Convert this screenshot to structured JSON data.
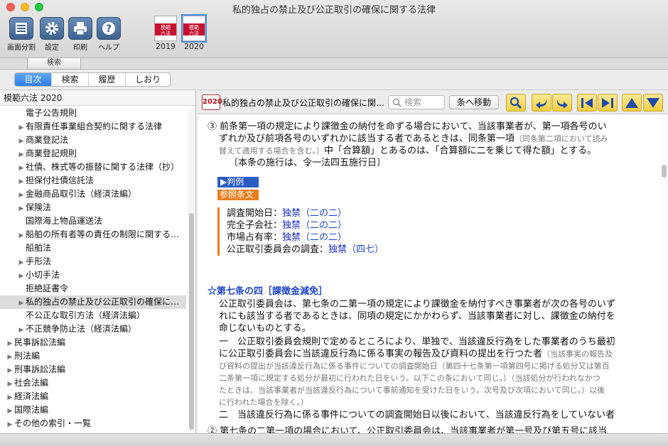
{
  "window": {
    "title": "私的独占の禁止及び公正取引の確保に関する法律"
  },
  "toolbar": {
    "split_label": "画面分割",
    "settings_label": "設定",
    "print_label": "印刷",
    "help_label": "ヘルプ",
    "book_2019_label": "2019",
    "book_2020_label": "2020",
    "book_cover_text_line1": "模範",
    "book_cover_text_line2": "六法",
    "book_2019_cover_year": "2019",
    "book_2020_cover_year": "2020",
    "search_tab_label": "検索"
  },
  "tabs": [
    {
      "label": "目次",
      "active": true
    },
    {
      "label": "検索",
      "active": false
    },
    {
      "label": "履歴",
      "active": false
    },
    {
      "label": "しおり",
      "active": false
    }
  ],
  "sidebar": {
    "header": "模範六法 2020",
    "items": [
      {
        "label": "電子公告規則",
        "level": "l2n",
        "arrow": ""
      },
      {
        "label": "有限責任事業組合契約に関する法律",
        "level": "l2",
        "arrow": "▶"
      },
      {
        "label": "商業登記法",
        "level": "l2",
        "arrow": "▶"
      },
      {
        "label": "商業登記規則",
        "level": "l2",
        "arrow": "▶"
      },
      {
        "label": "社債、株式等の振替に関する法律（抄）",
        "level": "l2",
        "arrow": "▶"
      },
      {
        "label": "担保付社債信託法",
        "level": "l2",
        "arrow": "▶"
      },
      {
        "label": "金融商品取引法（経済法編）",
        "level": "l2",
        "arrow": "▶"
      },
      {
        "label": "保険法",
        "level": "l2",
        "arrow": "▶"
      },
      {
        "label": "国際海上物品運送法",
        "level": "l2n",
        "arrow": ""
      },
      {
        "label": "船舶の所有者等の責任の制限に関する…",
        "level": "l2",
        "arrow": "▶"
      },
      {
        "label": "船舶法",
        "level": "l2n",
        "arrow": ""
      },
      {
        "label": "手形法",
        "level": "l2",
        "arrow": "▶"
      },
      {
        "label": "小切手法",
        "level": "l2",
        "arrow": "▶"
      },
      {
        "label": "拒絶証書令",
        "level": "l2n",
        "arrow": ""
      },
      {
        "label": "私的独占の禁止及び公正取引の確保に…",
        "level": "l2",
        "arrow": "▶",
        "selected": true
      },
      {
        "label": "不公正な取引方法（経済法編）",
        "level": "l2n",
        "arrow": ""
      },
      {
        "label": "不正競争防止法（経済法編）",
        "level": "l2",
        "arrow": "▶"
      },
      {
        "label": "民事訴訟法編",
        "level": "l1",
        "arrow": "▶"
      },
      {
        "label": "刑法編",
        "level": "l1",
        "arrow": "▶"
      },
      {
        "label": "刑事訴訟法編",
        "level": "l1",
        "arrow": "▶"
      },
      {
        "label": "社会法編",
        "level": "l1",
        "arrow": "▶"
      },
      {
        "label": "経済法編",
        "level": "l1",
        "arrow": "▶"
      },
      {
        "label": "国際法編",
        "level": "l1",
        "arrow": "▶"
      },
      {
        "label": "その他の索引・一覧",
        "level": "l1",
        "arrow": "▶"
      }
    ]
  },
  "viewer": {
    "year_badge": "2020",
    "doc_title": "私的独占の禁止及び公正取引の確保に関…",
    "search_placeholder": "検索",
    "jump_label": "条へ移動"
  },
  "doc": {
    "p3_num": "③",
    "p3_line1": "前条第一項の規定により課徴金の納付を命ずる場合において、当該事業者が、第一項各号のい",
    "p3_line2": "ずれか及び前項各号のいずれかに該当する者であるときは、同条第一項",
    "p3_note": "（同条第二項において読み",
    "p3_line3_note": "替えて適用する場合を含む。）",
    "p3_line3": "中「合算額」とあるのは、「合算額に二を乗じて得た額」とする。",
    "p3_line4": "〔本条の施行は、令一法四五施行日〕",
    "hanrei_label": "▶判例",
    "sansho_label": "参照条文",
    "refs": [
      {
        "term": "調査開始日：",
        "law": "独禁",
        "art": "（二の二）"
      },
      {
        "term": "完全子会社：",
        "law": "独禁",
        "art": "（二の二）"
      },
      {
        "term": "市場占有率：",
        "law": "独禁",
        "art": "（二の二）"
      },
      {
        "term": "公正取引委員会の調査：",
        "law": "独禁",
        "art": "（四七）"
      }
    ],
    "art_heading": "☆第七条の四［課徴金減免］",
    "a1_line1": "公正取引委員会は、第七条の二第一項の規定により課徴金を納付すべき事業者が次の各号のいず",
    "a1_line2": "れにも該当する者であるときは、同項の規定にかかわらず、当該事業者に対し、課徴金の納付を",
    "a1_line3": "命じないものとする。",
    "i1_line1": "一　公正取引委員会規則で定めるところにより、単独で、当該違反行為をした事業者のうち最初",
    "i1_line2": "に公正取引委員会に当該違反行為に係る事実の報告及び資料の提出を行つた者",
    "i1_note1": "（当該事実の報告及",
    "i1_note2": "び資料の提出が当該違反行為に係る事件についての調査開始日（第四十七条第一項第四号に掲げる処分又は第百",
    "i1_note3": "二条第一項に規定する処分が最初に行われた日をいう。以下この条において同じ。）（当該処分が行われなかつ",
    "i1_note4": "たときは、当該事業者が当該違反行為について事前通知を受けた日をいう。次号及び次項において同じ。）以後",
    "i1_note5": "に行われた場合を除く。）",
    "i2_line1": "二　当該違反行為に係る事件についての調査開始日以後において、当該違反行為をしていない者",
    "p2_line1": "② 第七条の二第一項の場合において、公正取引委員会は、当該事業者が第一号及び第五号に該当"
  },
  "colors": {
    "accent": "#2f7fe6",
    "link": "#1428c8",
    "orange": "#e97d1a",
    "nav_yellow": "#f5cf3e"
  }
}
